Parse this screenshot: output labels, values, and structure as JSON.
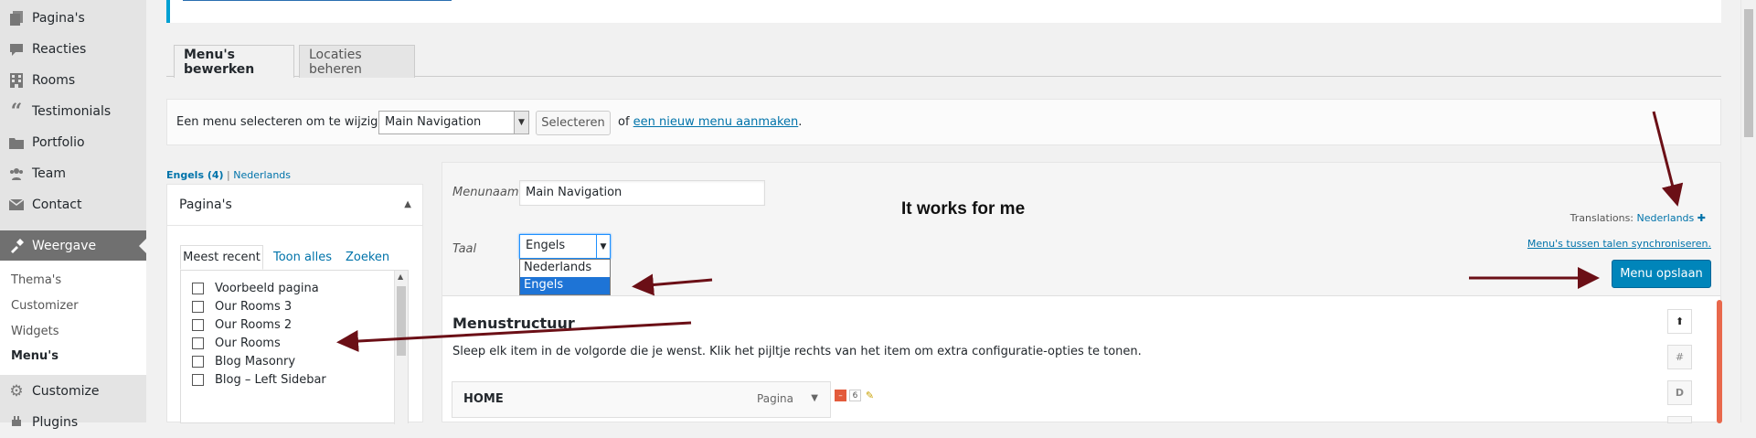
{
  "sidebar": {
    "top_items": [
      {
        "label": "Pagina's",
        "icon": "pages-icon"
      },
      {
        "label": "Reacties",
        "icon": "comments-icon"
      },
      {
        "label": "Rooms",
        "icon": "rooms-icon"
      },
      {
        "label": "Testimonials",
        "icon": "quote-icon"
      },
      {
        "label": "Portfolio",
        "icon": "portfolio-icon"
      },
      {
        "label": "Team",
        "icon": "team-icon"
      },
      {
        "label": "Contact",
        "icon": "mail-icon"
      }
    ],
    "active": {
      "label": "Weergave",
      "icon": "appearance-icon"
    },
    "sub_items": [
      "Thema's",
      "Customizer",
      "Widgets",
      "Menu's"
    ],
    "bottom_items": [
      {
        "label": "Customize",
        "icon": "gear-icon"
      },
      {
        "label": "Plugins",
        "icon": "plugin-icon"
      }
    ]
  },
  "tabs": {
    "edit": "Menu's bewerken",
    "locations": "Locaties beheren"
  },
  "select_bar": {
    "label": "Een menu selecteren om te wijzigen:",
    "selected": "Main Navigation",
    "button": "Selecteren",
    "or_text": "of",
    "create_link": "een nieuw menu aanmaken",
    "period": "."
  },
  "lang_links": {
    "current": "Engels (4)",
    "separator": "|",
    "other": "Nederlands"
  },
  "pages_panel": {
    "title": "Pagina's",
    "tabs": {
      "recent": "Meest recent",
      "all": "Toon alles",
      "search": "Zoeken"
    },
    "items": [
      "Voorbeeld pagina",
      "Our Rooms 3",
      "Our Rooms 2",
      "Our Rooms",
      "Blog Masonry",
      "Blog – Left Sidebar"
    ]
  },
  "menu_editor": {
    "menu_name_label": "Menunaam",
    "menu_name_value": "Main Navigation",
    "language_label": "Taal",
    "language_selected": "Engels",
    "language_options": [
      "Nederlands",
      "Engels"
    ],
    "annotation": "It works for me",
    "translations_label": "Translations:",
    "translations_link": "Nederlands",
    "sync_link": "Menu's tussen talen synchroniseren.",
    "save_button": "Menu opslaan",
    "structure_title": "Menustructuur",
    "structure_desc": "Sleep elk item in de volgorde die je wenst. Klik het pijltje rechts van het item om extra configuratie-opties te tonen.",
    "items": [
      {
        "title": "HOME",
        "type": "Pagina",
        "badge_minus": "–",
        "badge_num": "6"
      }
    ],
    "side_buttons": [
      "⬆",
      "#",
      "D"
    ]
  },
  "colors": {
    "accent": "#0073aa",
    "primary_button": "#0085ba",
    "annotation_arrow": "#6b0f16",
    "active_menu_bg": "#707070",
    "orange_bar": "#e8684c"
  }
}
